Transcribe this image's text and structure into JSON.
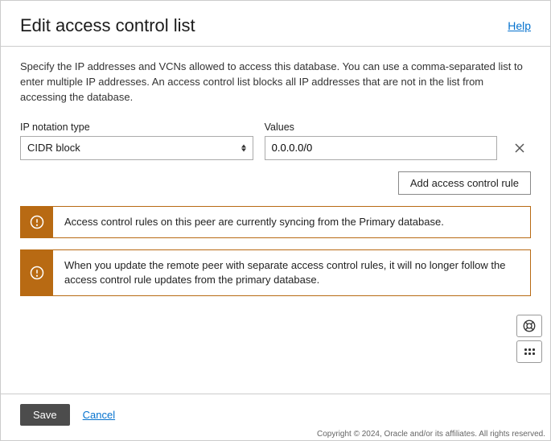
{
  "header": {
    "title": "Edit access control list",
    "help": "Help"
  },
  "description": "Specify the IP addresses and VCNs allowed to access this database. You can use a comma-separated list to enter multiple IP addresses. An access control list blocks all IP addresses that are not in the list from accessing the database.",
  "form": {
    "ip_type_label": "IP notation type",
    "ip_type_value": "CIDR block",
    "values_label": "Values",
    "values_value": "0.0.0.0/0"
  },
  "add_rule_label": "Add access control rule",
  "alerts": [
    "Access control rules on this peer are currently syncing from the Primary database.",
    "When you update the remote peer with separate access control rules, it will no longer follow the access control rule updates from the primary database."
  ],
  "footer": {
    "save": "Save",
    "cancel": "Cancel",
    "copyright": "Copyright © 2024, Oracle and/or its affiliates. All rights reserved."
  }
}
